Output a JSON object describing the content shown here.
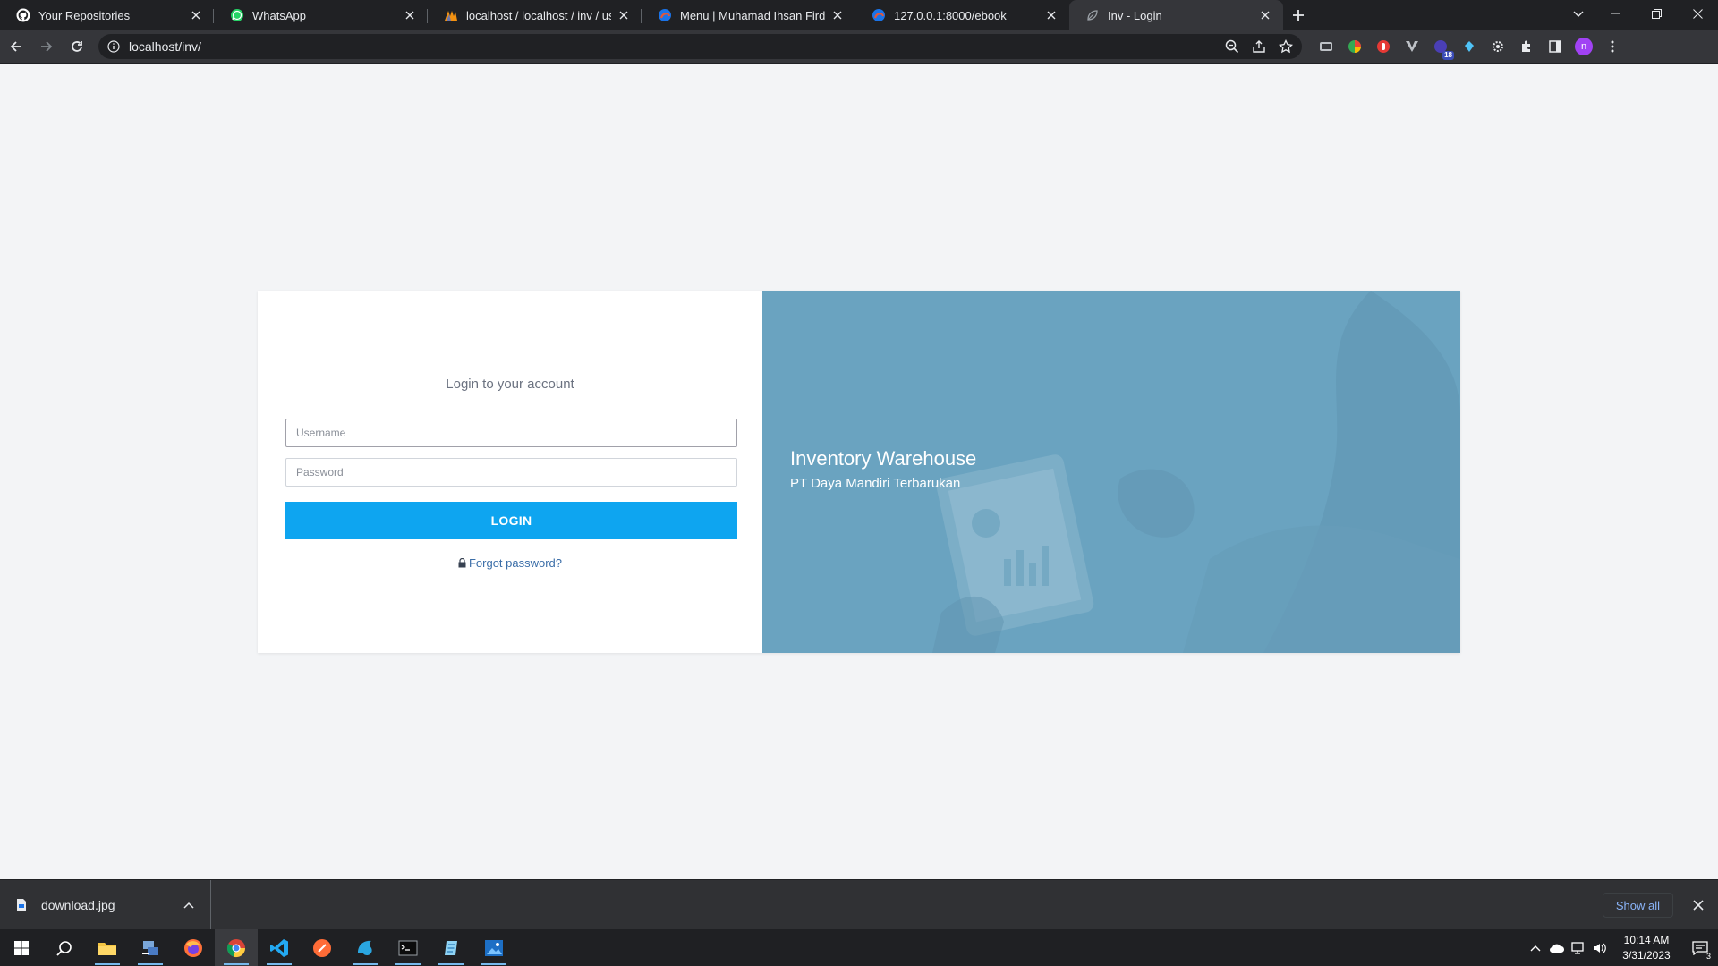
{
  "browser": {
    "tabs": [
      {
        "title": "Your Repositories",
        "icon": "github-icon"
      },
      {
        "title": "WhatsApp",
        "icon": "whatsapp-icon"
      },
      {
        "title": "localhost / localhost / inv / user | phpMyAdmin",
        "icon": "phpmyadmin-icon"
      },
      {
        "title": "Menu | Muhamad Ihsan Firdaus",
        "icon": "edge-icon"
      },
      {
        "title": "127.0.0.1:8000/ebook",
        "icon": "edge-icon"
      },
      {
        "title": "Inv - Login",
        "icon": "leaf-icon"
      }
    ],
    "url": "localhost/inv/",
    "extension_badge": "18",
    "profile_initial": "n"
  },
  "login": {
    "heading": "Login to your account",
    "username_placeholder": "Username",
    "password_placeholder": "Password",
    "button_label": "LOGIN",
    "forgot_label": "Forgot password?"
  },
  "hero": {
    "title": "Inventory Warehouse",
    "subtitle": "PT Daya Mandiri Terbarukan"
  },
  "downloads": {
    "file_name": "download.jpg",
    "show_all_label": "Show all"
  },
  "taskbar": {
    "time": "10:14 AM",
    "date": "3/31/2023",
    "notification_count": "3"
  },
  "colors": {
    "login_button": "#0ea5f0",
    "hero_background": "#6aa3c0",
    "page_background": "#f3f4f6"
  }
}
